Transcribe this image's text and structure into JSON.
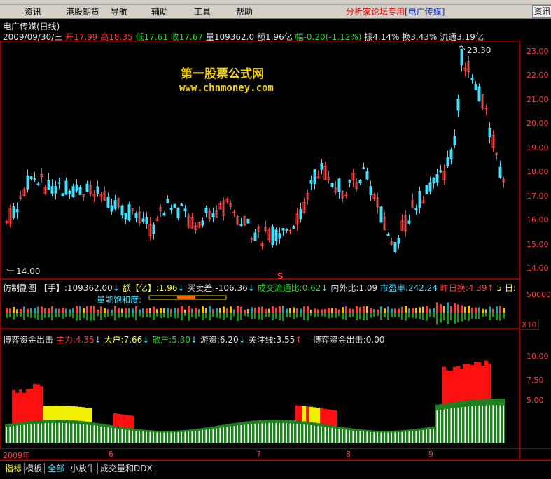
{
  "menu": {
    "items": [
      "资讯",
      "港股期货",
      "导航",
      "辅助",
      "工具",
      "帮助"
    ],
    "brand_red": "分析家论坛专用",
    "brand_blue": "[电广传媒]",
    "right_button": "资讯"
  },
  "main_pane": {
    "title": "电广传媒(日线)",
    "date": "2009/09/30/三",
    "open_label": "开",
    "open": "17.99",
    "high_label": "高",
    "high": "18.35",
    "low_label": "低",
    "low": "17.61",
    "close_label": "收",
    "close": "17.67",
    "volume_label": "量",
    "volume": "109362.0",
    "amount_label": "额",
    "amount": "1.96亿",
    "change_label": "幅",
    "change": "-0.20(-1.12%)",
    "amplitude_label": "振",
    "amplitude": "4.14%",
    "turnover_label": "换",
    "turnover": "3.43%",
    "float_label": "流通",
    "float": "3.19亿",
    "max_marker": "23.30",
    "min_marker": "14.00",
    "s_marker": "S",
    "price_axis": [
      "23.00",
      "22.00",
      "21.00",
      "20.00",
      "19.00",
      "18.00",
      "17.00",
      "16.00",
      "15.00",
      "14.00"
    ]
  },
  "watermark": {
    "line1": "第一股票公式网",
    "line2": "www.chnmoney.com"
  },
  "sub_pane1": {
    "name": "仿制副图",
    "hand_label": "【手】",
    "hand_value": ":109362.00",
    "amount_label": "额【亿】",
    "amount_value": ":1.96",
    "diff_label": "买卖差",
    "diff_value": ":-106.36",
    "flow_label": "成交流通比",
    "flow_value": ":0.62",
    "inout_label": "内外比",
    "inout_value": ":1.09",
    "pe_label": "市盈率",
    "pe_value": ":242.24",
    "prev_label": "昨日换",
    "prev_value": ":4.39",
    "days_label": "5 日:",
    "saturation_label": "量能饱和度:",
    "axis": [
      "50000"
    ],
    "multiplier": "X10"
  },
  "sub_pane2": {
    "name": "博弈资金出击",
    "main_label": "主力",
    "main_value": ":4.35",
    "big_label": "大户",
    "big_value": ":7.66",
    "retail_label": "散户",
    "retail_value": ":5.30",
    "hot_label": "游资",
    "hot_value": ":6.20",
    "focus_label": "关注线",
    "focus_value": ":3.55",
    "name2": "博弈资金出击",
    "name2_value": ":0.00",
    "axis": [
      "10.00",
      "7.50",
      "5.00"
    ]
  },
  "time_axis": [
    "2009年",
    "6",
    "7",
    "8",
    "9"
  ],
  "bottom_tabs": [
    "指标",
    "模板",
    "全部",
    "小放牛",
    "成交量和DDX"
  ],
  "colors": {
    "up": "#ff3c3c",
    "down": "#40e0ff",
    "grid": "#8b0000",
    "accent": "#f0d000"
  }
}
